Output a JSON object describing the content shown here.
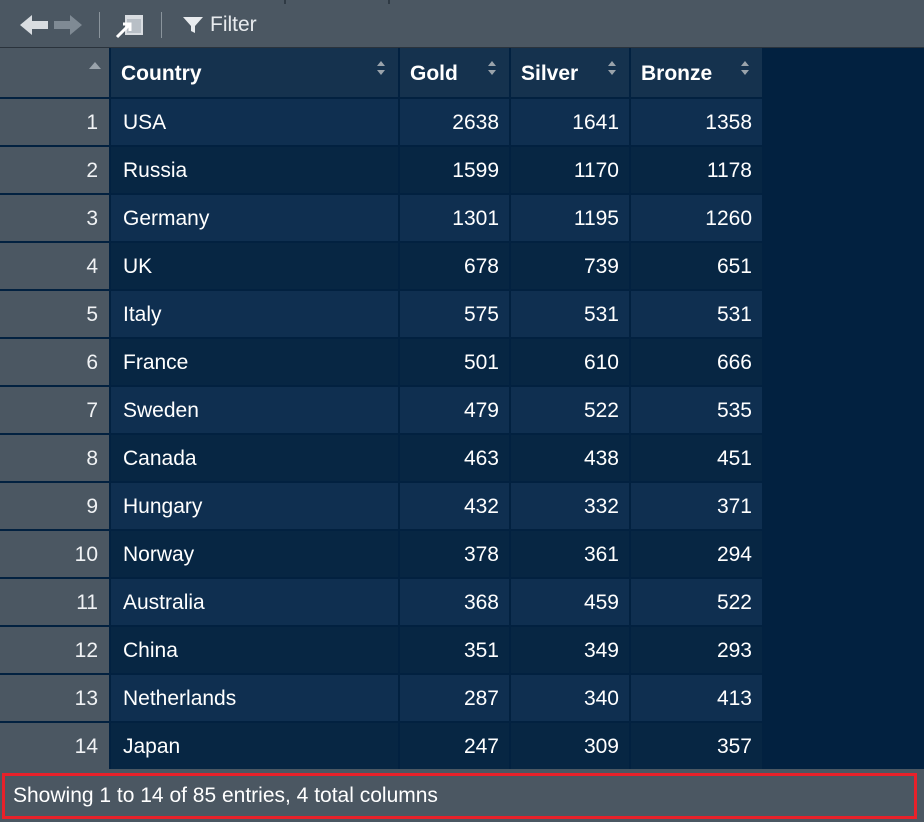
{
  "toolbar": {
    "back_icon": "arrow-left-icon",
    "forward_icon": "arrow-right-icon",
    "popout_icon": "popout-icon",
    "filter_icon": "funnel-icon",
    "filter_label": "Filter"
  },
  "table": {
    "columns": [
      "Country",
      "Gold",
      "Silver",
      "Bronze"
    ],
    "rows": [
      {
        "idx": "1",
        "country": "USA",
        "gold": "2638",
        "silver": "1641",
        "bronze": "1358"
      },
      {
        "idx": "2",
        "country": "Russia",
        "gold": "1599",
        "silver": "1170",
        "bronze": "1178"
      },
      {
        "idx": "3",
        "country": "Germany",
        "gold": "1301",
        "silver": "1195",
        "bronze": "1260"
      },
      {
        "idx": "4",
        "country": "UK",
        "gold": "678",
        "silver": "739",
        "bronze": "651"
      },
      {
        "idx": "5",
        "country": "Italy",
        "gold": "575",
        "silver": "531",
        "bronze": "531"
      },
      {
        "idx": "6",
        "country": "France",
        "gold": "501",
        "silver": "610",
        "bronze": "666"
      },
      {
        "idx": "7",
        "country": "Sweden",
        "gold": "479",
        "silver": "522",
        "bronze": "535"
      },
      {
        "idx": "8",
        "country": "Canada",
        "gold": "463",
        "silver": "438",
        "bronze": "451"
      },
      {
        "idx": "9",
        "country": "Hungary",
        "gold": "432",
        "silver": "332",
        "bronze": "371"
      },
      {
        "idx": "10",
        "country": "Norway",
        "gold": "378",
        "silver": "361",
        "bronze": "294"
      },
      {
        "idx": "11",
        "country": "Australia",
        "gold": "368",
        "silver": "459",
        "bronze": "522"
      },
      {
        "idx": "12",
        "country": "China",
        "gold": "351",
        "silver": "349",
        "bronze": "293"
      },
      {
        "idx": "13",
        "country": "Netherlands",
        "gold": "287",
        "silver": "340",
        "bronze": "413"
      },
      {
        "idx": "14",
        "country": "Japan",
        "gold": "247",
        "silver": "309",
        "bronze": "357"
      }
    ]
  },
  "status": {
    "text": "Showing 1 to 14 of 85 entries, 4 total columns"
  },
  "colors": {
    "background": "#022140",
    "toolbar": "#4b5762",
    "highlight_border": "#e8212a"
  }
}
